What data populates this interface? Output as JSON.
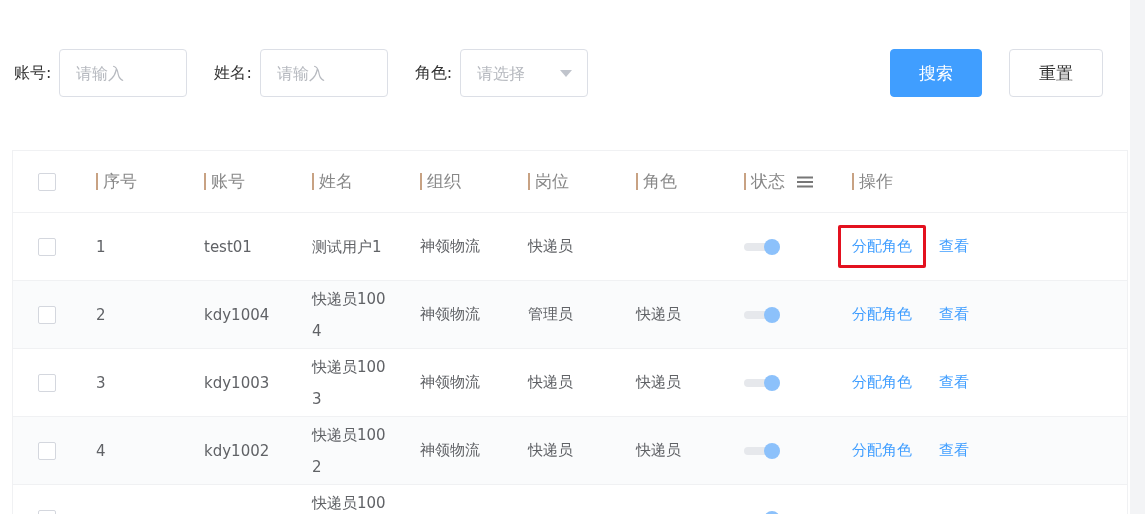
{
  "filters": [
    {
      "kind": "input",
      "label": "账号:",
      "placeholder": "请输入"
    },
    {
      "kind": "input",
      "label": "姓名:",
      "placeholder": "请输入"
    },
    {
      "kind": "select",
      "label": "角色:",
      "placeholder": "请选择"
    }
  ],
  "buttons": [
    {
      "label": "搜索",
      "kind": "primary"
    },
    {
      "label": "重置",
      "kind": "default"
    }
  ],
  "table": {
    "select_all_checked": false,
    "columns": [
      "序号",
      "账号",
      "姓名",
      "组织",
      "岗位",
      "角色",
      "状态",
      "操作"
    ],
    "rows": [
      {
        "checked": false,
        "index": "1",
        "account": "test01",
        "name": "测试用户1",
        "org": "神领物流",
        "post": "快递员",
        "status_on": true,
        "actions": [
          "分配角色",
          "查看"
        ],
        "highlighted": true
      },
      {
        "checked": false,
        "index": "2",
        "account": "kdy1004",
        "name": "快递员1004",
        "org": "神领物流",
        "post": "管理员",
        "role": "快递员",
        "status_on": true,
        "actions": [
          "分配角色",
          "查看"
        ],
        "highlighted": false
      },
      {
        "checked": false,
        "index": "3",
        "account": "kdy1003",
        "name": "快递员1003",
        "org": "神领物流",
        "post": "快递员",
        "role": "快递员",
        "status_on": true,
        "actions": [
          "分配角色",
          "查看"
        ],
        "highlighted": false
      },
      {
        "checked": false,
        "index": "4",
        "account": "kdy1002",
        "name": "快递员1002",
        "org": "神领物流",
        "post": "快递员",
        "role": "快递员",
        "status_on": true,
        "actions": [
          "分配角色",
          "查看"
        ],
        "highlighted": false
      },
      {
        "checked": false,
        "name": "快递员100",
        "status_on": true
      }
    ]
  }
}
